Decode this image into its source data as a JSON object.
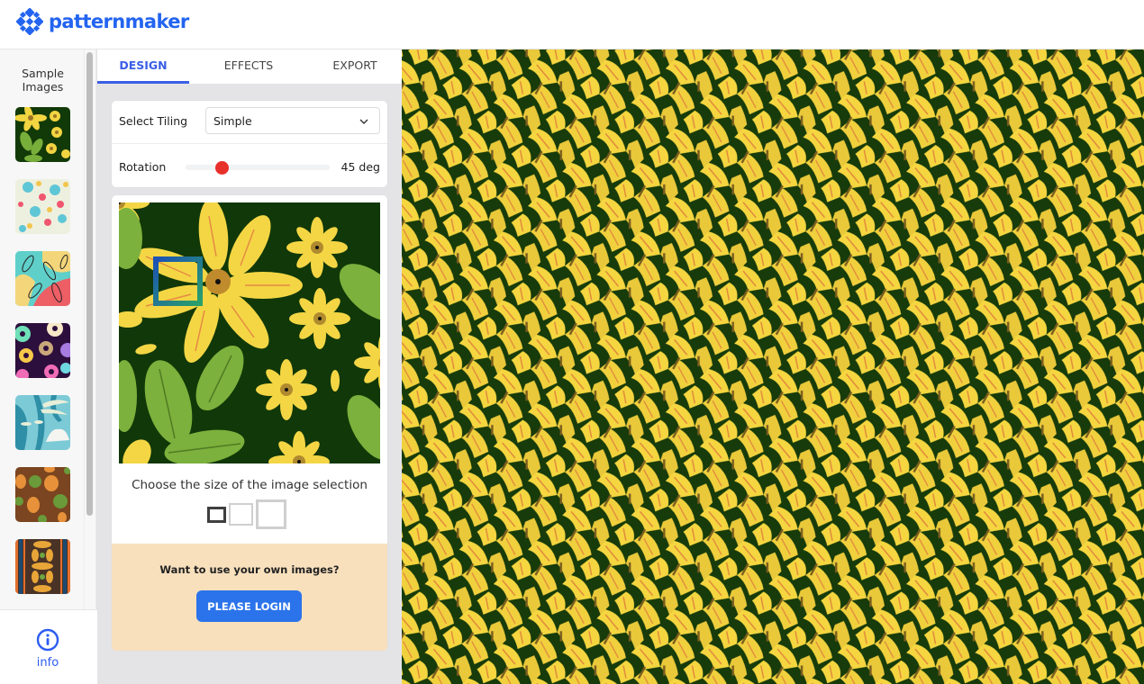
{
  "app": {
    "name": "patternmaker",
    "brand_color": "#2364f0"
  },
  "rail": {
    "title": "Sample Images",
    "samples": [
      {
        "name": "yellow-flowers-dark-green",
        "selected": true
      },
      {
        "name": "pastel-floral-cream"
      },
      {
        "name": "leaves-teal-coral-yellow"
      },
      {
        "name": "donuts-dark-purple"
      },
      {
        "name": "tropical-blue-white"
      },
      {
        "name": "pineapples-brown"
      },
      {
        "name": "damask-stripes-orange-navy"
      }
    ],
    "info_label": "info"
  },
  "panel": {
    "tabs": [
      {
        "label": "DESIGN",
        "active": true
      },
      {
        "label": "EFFECTS",
        "active": false
      },
      {
        "label": "EXPORT",
        "active": false
      }
    ],
    "tiling": {
      "label": "Select Tiling",
      "value": "Simple"
    },
    "rotation": {
      "label": "Rotation",
      "value": 45,
      "min": 0,
      "max": 180,
      "display": "45 deg",
      "thumb_color": "#e8302a"
    },
    "selection": {
      "caption": "Choose the size of the image selection",
      "sizes": [
        "small",
        "medium",
        "large"
      ],
      "selected_size": "small"
    },
    "login": {
      "prompt": "Want to use your own images?",
      "button_label": "PLEASE LOGIN",
      "button_color": "#2b73ea"
    }
  },
  "pattern": {
    "colors": {
      "background": "#173b0a",
      "petal": "#f5d640",
      "petal_dark": "#e2c33a",
      "vein": "#e08a3c",
      "center": "#8a6a24"
    }
  }
}
